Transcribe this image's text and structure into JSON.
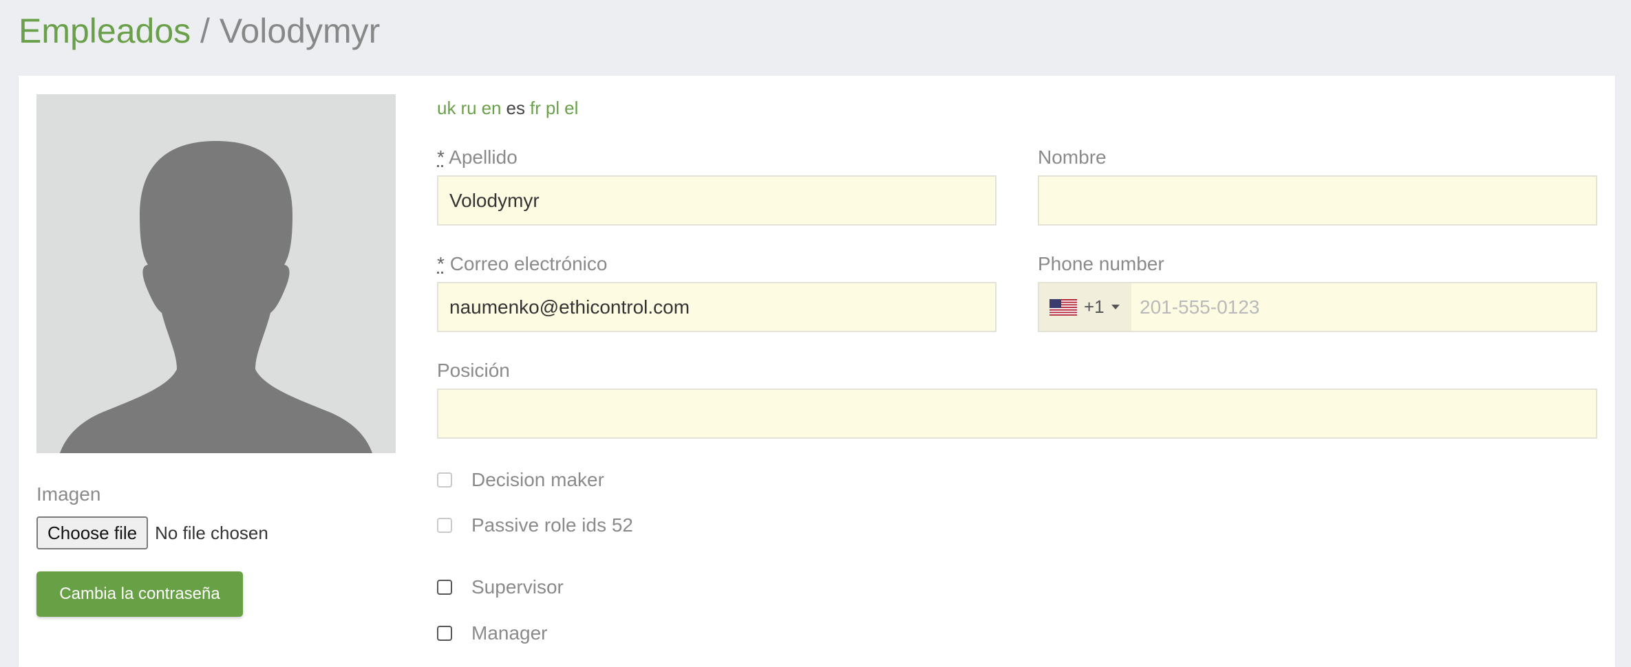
{
  "header": {
    "section": "Empleados",
    "separator": " / ",
    "employee_name": "Volodymyr"
  },
  "sidebar": {
    "image_label": "Imagen",
    "choose_file_label": "Choose file",
    "no_file_text": "No file chosen",
    "change_password_label": "Cambia la contraseña"
  },
  "languages": {
    "items": [
      "uk",
      "ru",
      "en",
      "es",
      "fr",
      "pl",
      "el"
    ],
    "active": "es"
  },
  "form": {
    "required_mark": "*",
    "last_name_label": "Apellido",
    "last_name_value": "Volodymyr",
    "first_name_label": "Nombre",
    "first_name_value": "",
    "email_label": "Correo electrónico",
    "email_value": "naumenko@ethicontrol.com",
    "phone_label": "Phone number",
    "phone_dial_code": "+1",
    "phone_country_flag": "us-flag-icon",
    "phone_placeholder": "201-555-0123",
    "position_label": "Posición",
    "position_value": ""
  },
  "checkboxes": [
    {
      "label": "Decision maker",
      "checked": false,
      "disabled": true
    },
    {
      "label": "Passive role ids 52",
      "checked": false,
      "disabled": true
    },
    {
      "label": "Supervisor",
      "checked": false,
      "disabled": false
    },
    {
      "label": "Manager",
      "checked": false,
      "disabled": false
    }
  ],
  "colors": {
    "accent": "#68a046",
    "input_background": "#fefbe3",
    "page_background": "#eceef2"
  }
}
